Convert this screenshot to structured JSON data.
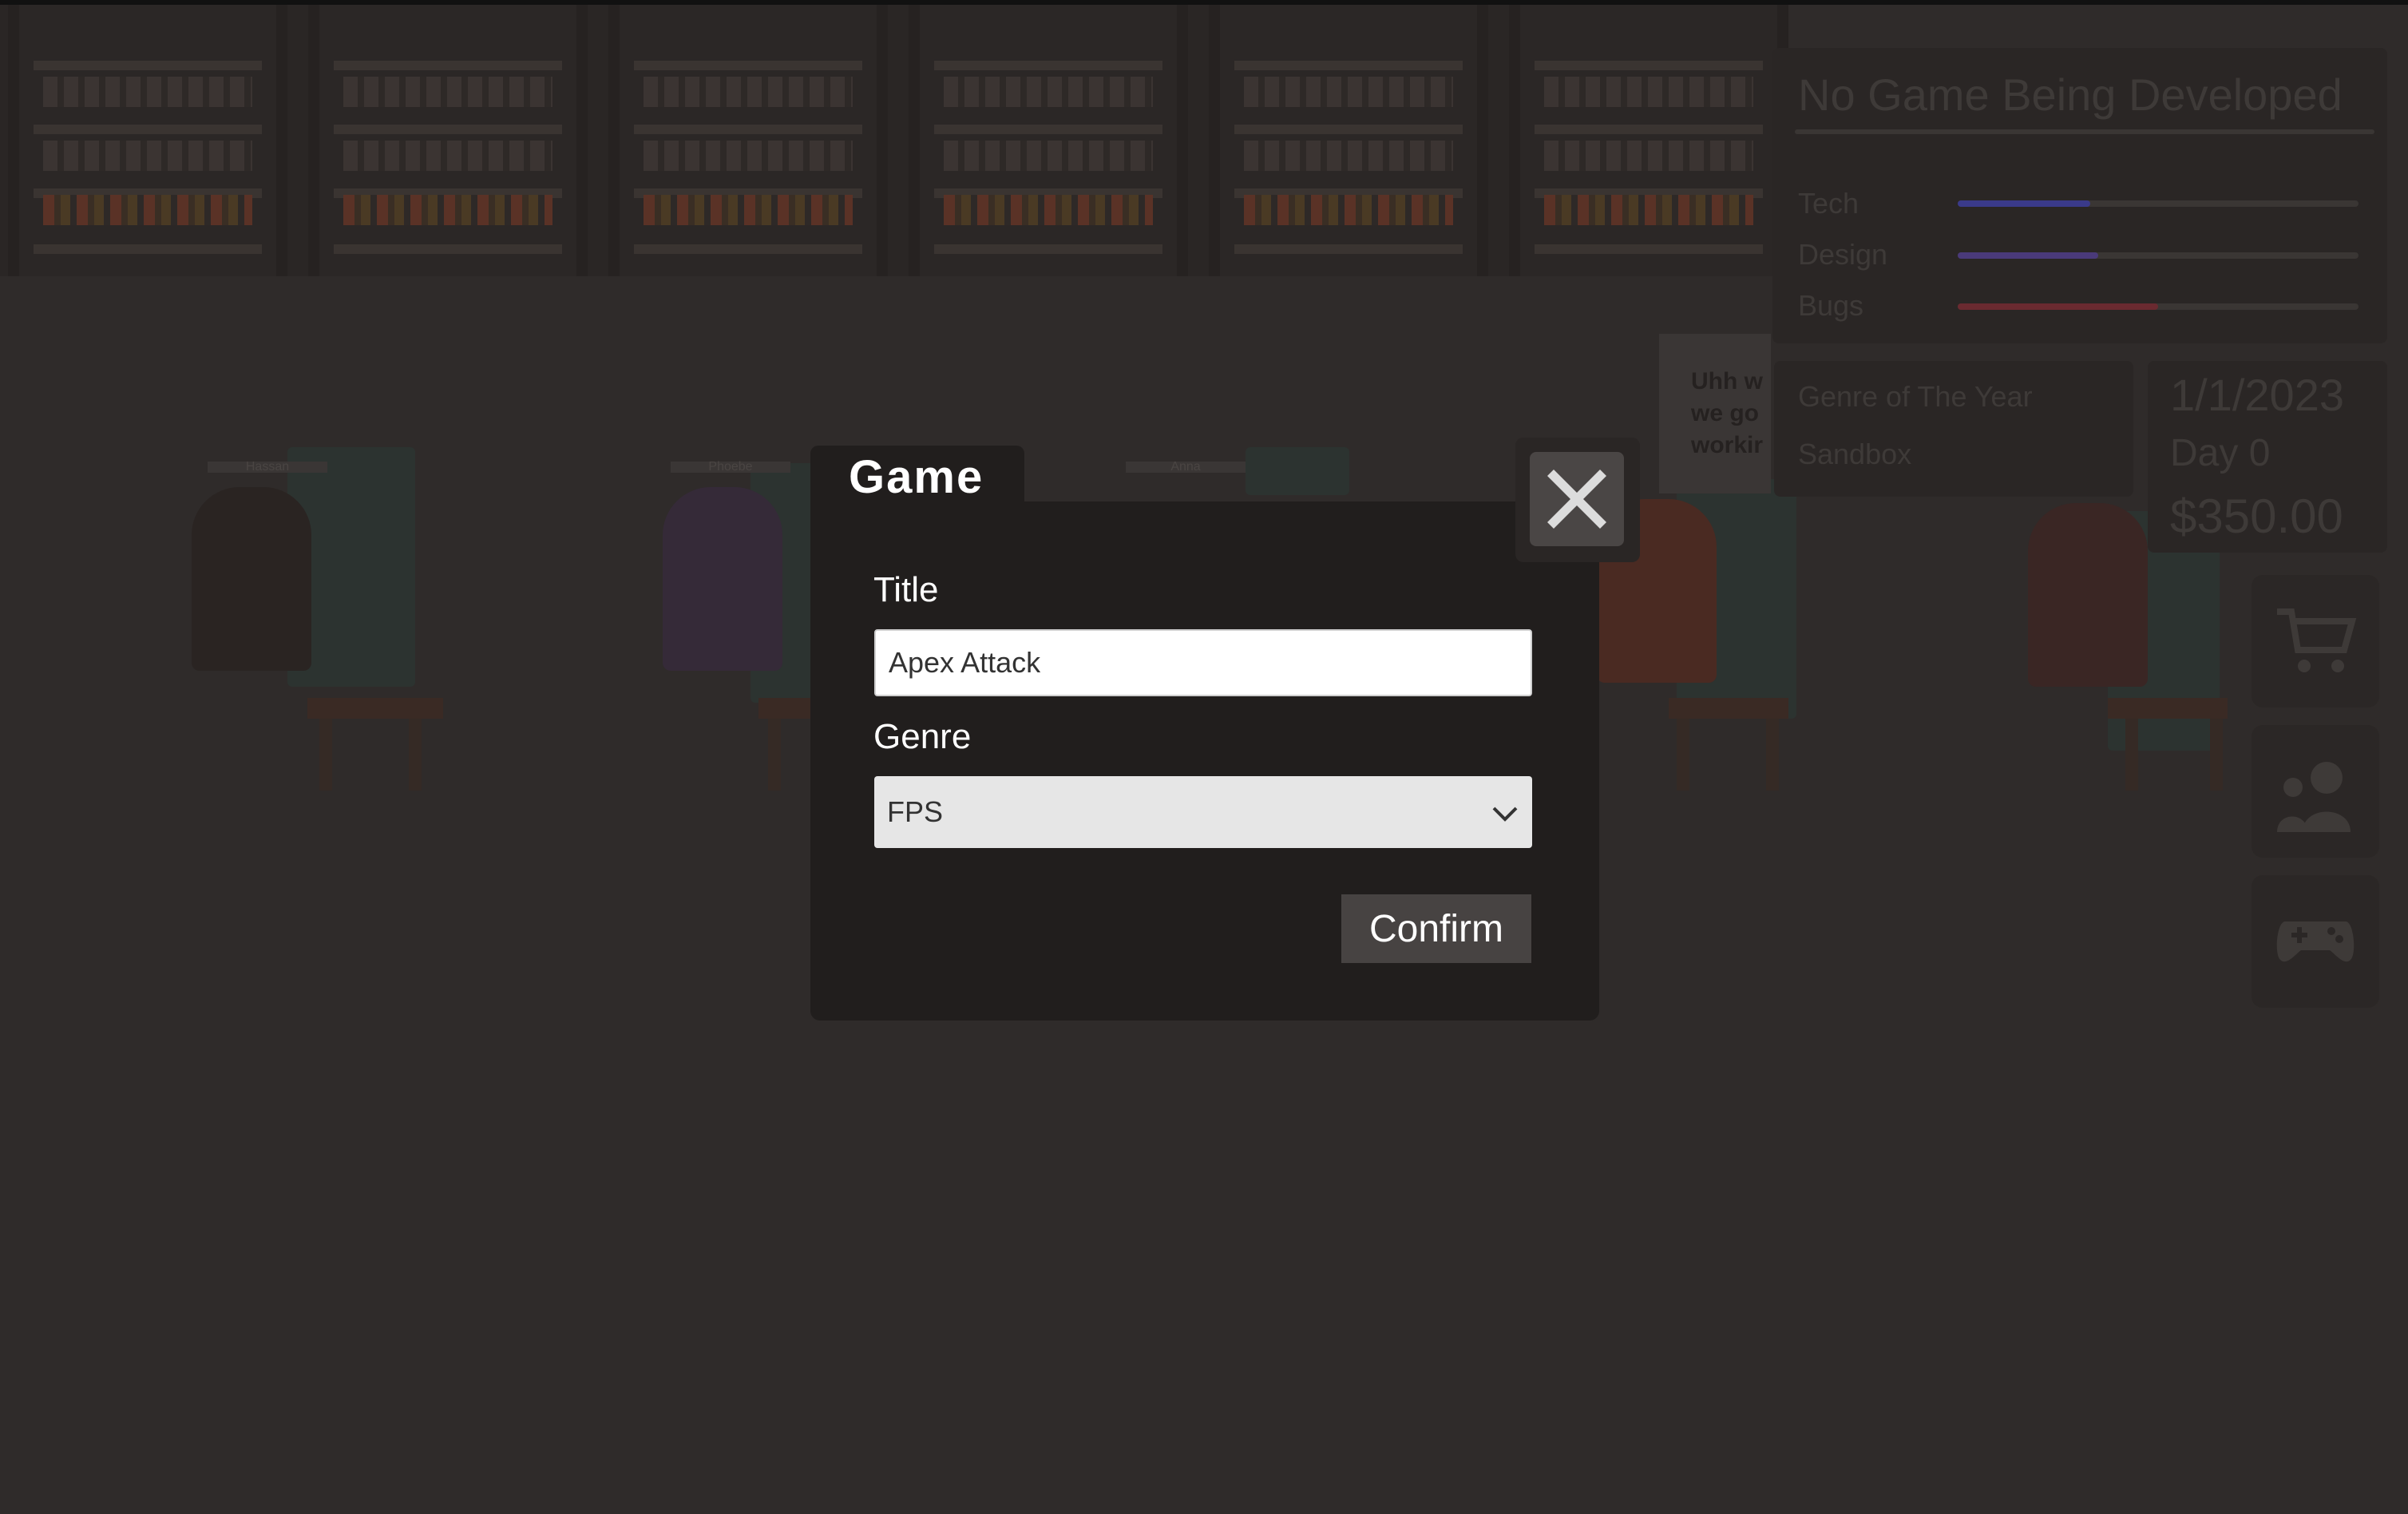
{
  "dialog": {
    "tab_title": "Game",
    "title_label": "Title",
    "title_value": "Apex Attack",
    "genre_label": "Genre",
    "genre_selected": "FPS",
    "confirm_label": "Confirm",
    "close_icon": "close-x-icon"
  },
  "hud": {
    "project_title": "No Game Being Developed",
    "stats": [
      {
        "label": "Tech",
        "progress": 0.33,
        "color": "#3a3a8a"
      },
      {
        "label": "Design",
        "progress": 0.35,
        "color": "#4a3a7a"
      },
      {
        "label": "Bugs",
        "progress": 0.5,
        "color": "#6a2a30"
      }
    ],
    "genre_of_year_label": "Genre of The Year",
    "genre_of_year_value": "Sandbox",
    "date": "1/1/2023",
    "day": "Day 0",
    "money": "$350.00",
    "speech_bubble": "Uhh w we go workir"
  },
  "side_buttons": [
    {
      "name": "shop-button",
      "icon": "cart-icon"
    },
    {
      "name": "hire-button",
      "icon": "people-icon"
    },
    {
      "name": "games-button",
      "icon": "gamepad-icon"
    }
  ],
  "workers": [
    "Hassan",
    "Phoebe",
    "Anna"
  ]
}
